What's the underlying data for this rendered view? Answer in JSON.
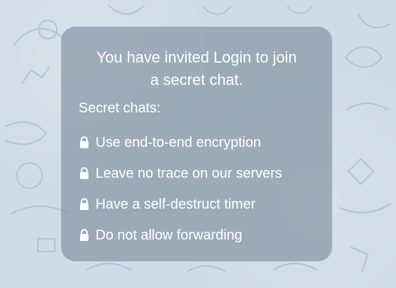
{
  "message_card": {
    "title_line1": "You have invited Login to join",
    "title_line2": "a secret chat.",
    "subheading": "Secret chats:",
    "features": [
      {
        "icon": "lock-icon",
        "text": "Use end-to-end encryption"
      },
      {
        "icon": "lock-icon",
        "text": "Leave no trace on our servers"
      },
      {
        "icon": "lock-icon",
        "text": "Have a self-destruct timer"
      },
      {
        "icon": "lock-icon",
        "text": "Do not allow forwarding"
      }
    ]
  },
  "colors": {
    "background": "#cfdbe6",
    "doodle": "#b2c3d4",
    "card": "#7d8c9b",
    "text": "#ffffff"
  }
}
